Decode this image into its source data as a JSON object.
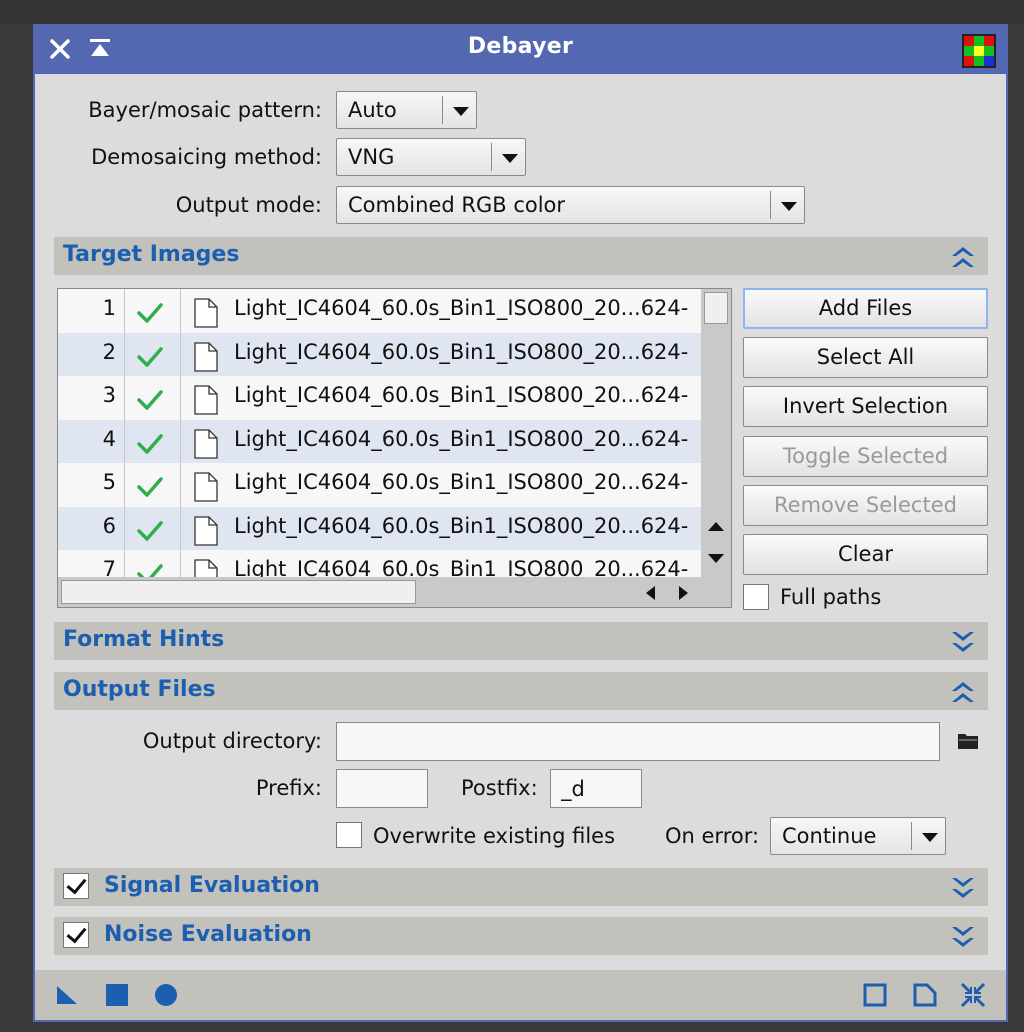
{
  "window": {
    "title": "Debayer"
  },
  "settings": {
    "bayer_label": "Bayer/mosaic pattern:",
    "bayer_value": "Auto",
    "demosaic_label": "Demosaicing method:",
    "demosaic_value": "VNG",
    "output_mode_label": "Output mode:",
    "output_mode_value": "Combined RGB color"
  },
  "sections": {
    "target_images": "Target Images",
    "format_hints": "Format Hints",
    "output_files": "Output Files",
    "signal_evaluation": "Signal Evaluation",
    "noise_evaluation": "Noise Evaluation"
  },
  "target_images": {
    "rows": [
      {
        "num": "1",
        "name": "Light_IC4604_60.0s_Bin1_ISO800_20...624-"
      },
      {
        "num": "2",
        "name": "Light_IC4604_60.0s_Bin1_ISO800_20...624-"
      },
      {
        "num": "3",
        "name": "Light_IC4604_60.0s_Bin1_ISO800_20...624-"
      },
      {
        "num": "4",
        "name": "Light_IC4604_60.0s_Bin1_ISO800_20...624-"
      },
      {
        "num": "5",
        "name": "Light_IC4604_60.0s_Bin1_ISO800_20...624-"
      },
      {
        "num": "6",
        "name": "Light_IC4604_60.0s_Bin1_ISO800_20...624-"
      },
      {
        "num": "7",
        "name": "Light_IC4604_60.0s_Bin1_ISO800_20...624-"
      }
    ],
    "buttons": {
      "add_files": "Add Files",
      "select_all": "Select All",
      "invert_selection": "Invert Selection",
      "toggle_selected": "Toggle Selected",
      "remove_selected": "Remove Selected",
      "clear": "Clear"
    },
    "full_paths_label": "Full paths"
  },
  "output_files": {
    "directory_label": "Output directory:",
    "directory_value": "",
    "prefix_label": "Prefix:",
    "prefix_value": "",
    "postfix_label": "Postfix:",
    "postfix_value": "_d",
    "overwrite_label": "Overwrite existing files",
    "on_error_label": "On error:",
    "on_error_value": "Continue"
  },
  "colors": {
    "titlebar": "#5468b2",
    "section_title": "#1c5fb0",
    "check_green": "#2fae4a"
  },
  "icons": {
    "close": "close-icon",
    "shade": "shade-icon",
    "app": "debayer-app-icon",
    "folder": "folder-icon"
  }
}
